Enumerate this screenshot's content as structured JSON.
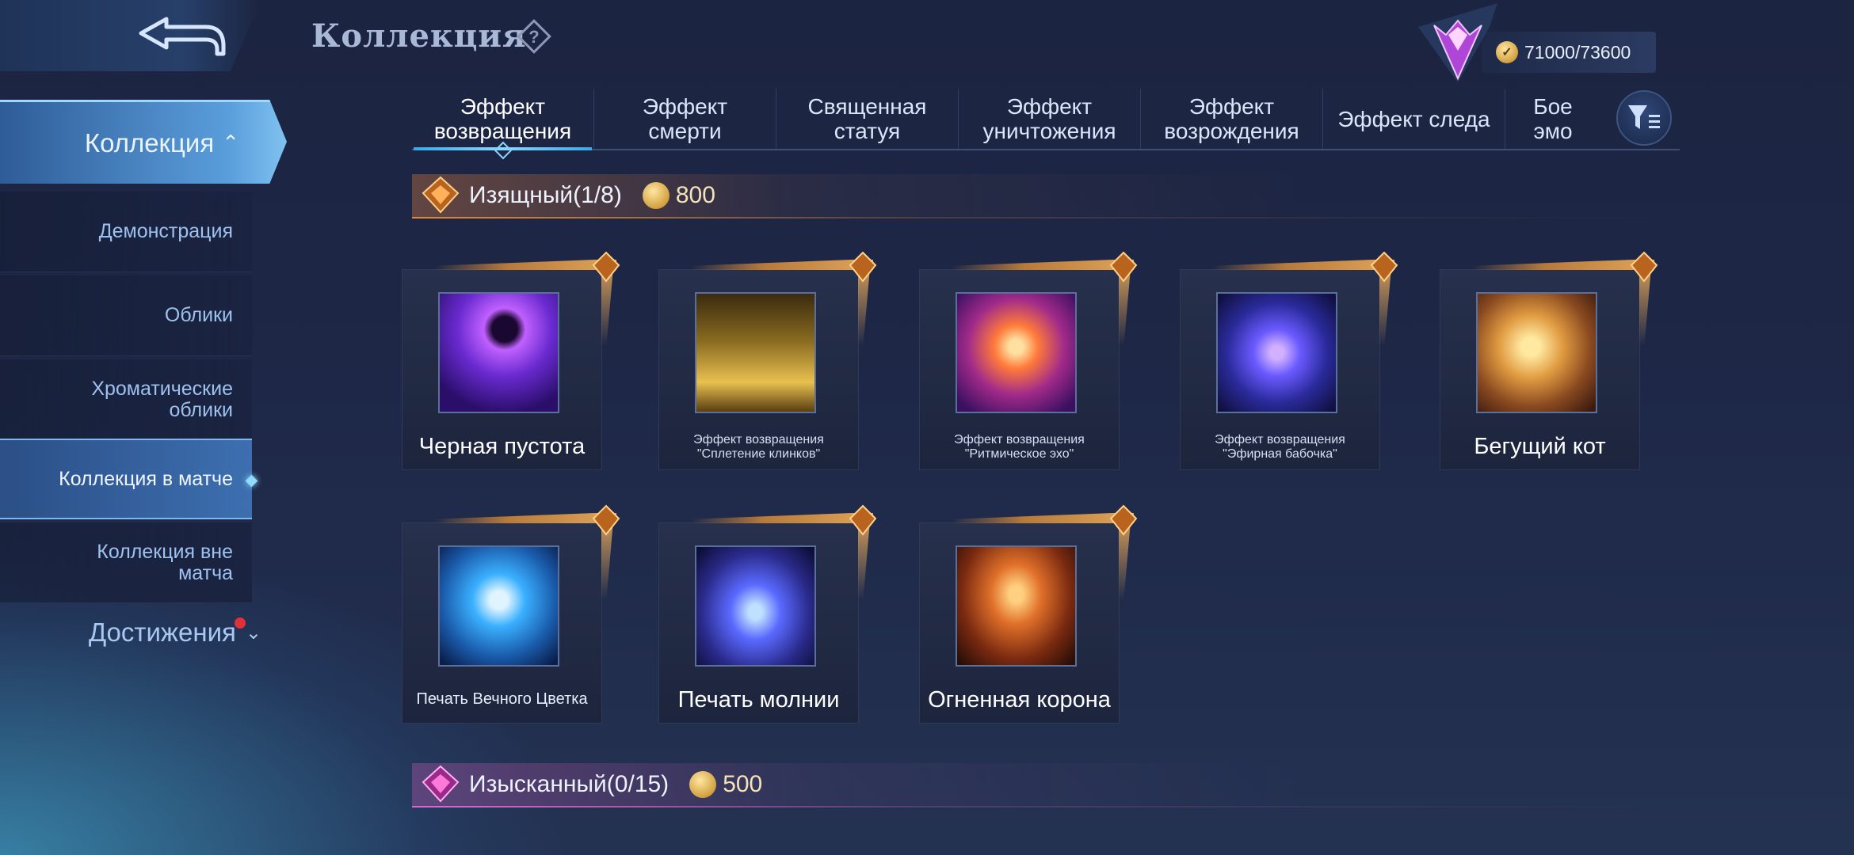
{
  "header": {
    "title": "Коллекция",
    "help_icon": "question-diamond-icon",
    "back_icon": "back-arrow-icon",
    "currency": "71000/73600",
    "currency_icon": "coin-icon"
  },
  "sidebar": {
    "main_label": "Коллекция",
    "items": [
      {
        "label": "Демонстрация"
      },
      {
        "label": "Облики"
      },
      {
        "label": "Хроматические облики"
      },
      {
        "label": "Коллекция в матче",
        "active": true
      },
      {
        "label": "Коллекция вне матча"
      }
    ],
    "achievements_label": "Достижения"
  },
  "tabs": [
    {
      "label": "Эффект возвращения",
      "active": true
    },
    {
      "label": "Эффект смерти"
    },
    {
      "label": "Священная статуя"
    },
    {
      "label": "Эффект уничтожения"
    },
    {
      "label": "Эффект возрождения"
    },
    {
      "label": "Эффект следа"
    },
    {
      "label": "Бое эмо"
    }
  ],
  "sections": [
    {
      "title": "Изящный(1/8)",
      "price": "800",
      "color": "#e08a3a"
    },
    {
      "title": "Изысканный(0/15)",
      "price": "500",
      "color": "#d96ad0"
    }
  ],
  "cards": [
    {
      "name": "Черная пустота"
    },
    {
      "name": "Эффект возвращения \"Сплетение клинков\""
    },
    {
      "name": "Эффект возвращения \"Ритмическое эхо\""
    },
    {
      "name": "Эффект возвращения \"Эфирная бабочка\""
    },
    {
      "name": "Бегущий кот"
    },
    {
      "name": "Печать Вечного Цветка"
    },
    {
      "name": "Печать молнии"
    },
    {
      "name": "Огненная корона"
    }
  ]
}
